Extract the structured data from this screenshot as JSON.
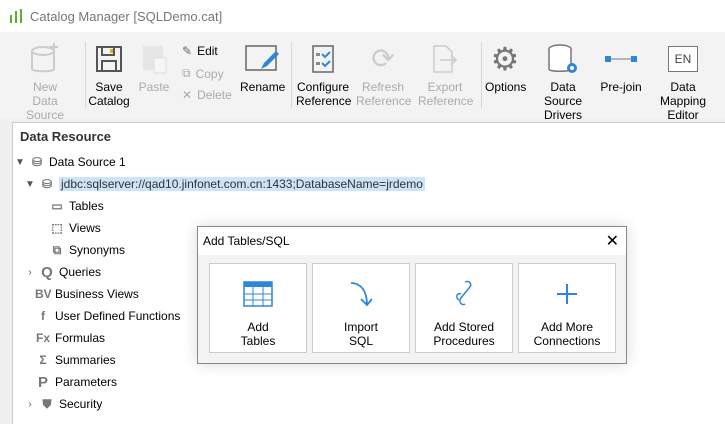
{
  "window": {
    "title": "Catalog Manager [SQLDemo.cat]"
  },
  "toolbar": {
    "new_ds": [
      "New",
      "Data Source"
    ],
    "save": [
      "Save",
      "Catalog"
    ],
    "paste": "Paste",
    "edit": "Edit",
    "copy": "Copy",
    "delete": "Delete",
    "rename": "Rename",
    "configure": [
      "Configure",
      "Reference"
    ],
    "refresh": [
      "Refresh",
      "Reference"
    ],
    "export": [
      "Export",
      "Reference"
    ],
    "options": "Options",
    "drivers": [
      "Data Source",
      "Drivers"
    ],
    "prejoin": "Pre-join",
    "mapping": [
      "Data Mapping",
      "Editor"
    ],
    "mapping_icon_text": "EN"
  },
  "panel": {
    "title": "Data Resource",
    "tree": {
      "ds": "Data Source 1",
      "conn": "jdbc:sqlserver://qad10.jinfonet.com.cn:1433;DatabaseName=jrdemo",
      "tables": "Tables",
      "views": "Views",
      "synonyms": "Synonyms",
      "queries": "Queries",
      "bv": "Business Views",
      "udf": "User Defined Functions",
      "formulas": "Formulas",
      "summaries": "Summaries",
      "parameters": "Parameters",
      "security": "Security"
    }
  },
  "dialog": {
    "title": "Add Tables/SQL",
    "tiles": [
      [
        "Add",
        "Tables"
      ],
      [
        "Import",
        "SQL"
      ],
      [
        "Add Stored",
        "Procedures"
      ],
      [
        "Add More",
        "Connections"
      ]
    ]
  },
  "colors": {
    "accent": "#2f86d8",
    "selection": "#cce4f7"
  }
}
